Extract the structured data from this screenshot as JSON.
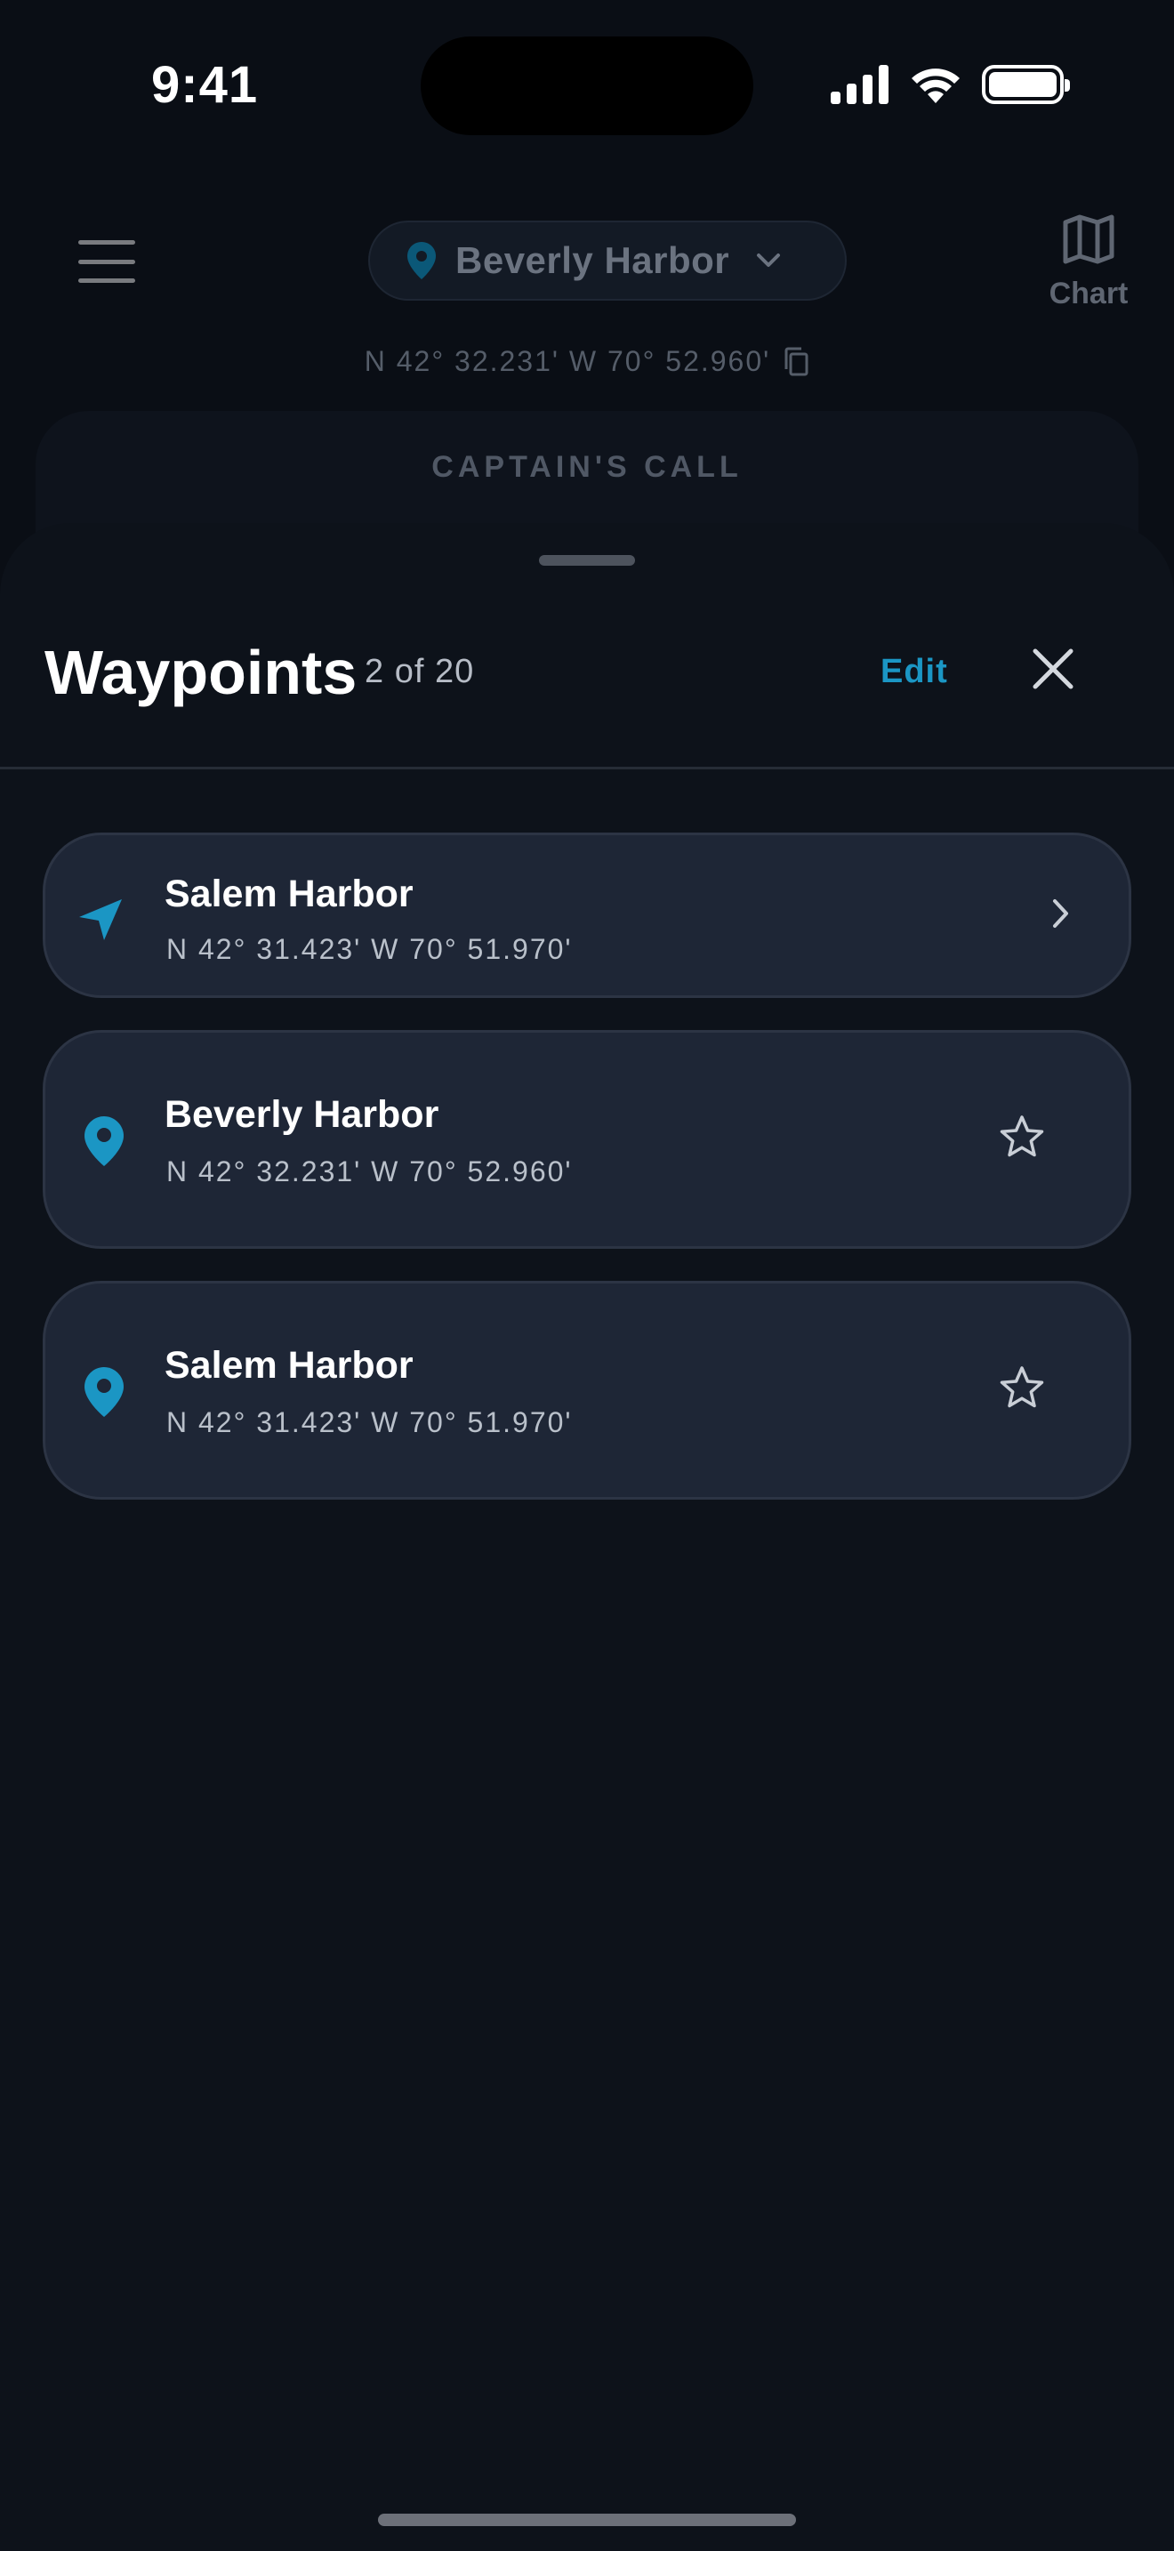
{
  "status_bar": {
    "time": "9:41"
  },
  "header": {
    "location_name": "Beverly Harbor",
    "chart_label": "Chart",
    "coordinates": "N 42° 32.231'  W 70° 52.960'"
  },
  "captain_call": {
    "label": "CAPTAIN'S CALL"
  },
  "sheet": {
    "title": "Waypoints",
    "count": "2 of 20",
    "edit_label": "Edit"
  },
  "waypoints": [
    {
      "name": "Salem Harbor",
      "coords": "N 42° 31.423'  W 70° 51.970'",
      "icon": "navigation-arrow-icon",
      "action": "chevron-right-icon"
    },
    {
      "name": "Beverly Harbor",
      "coords": "N 42° 32.231'  W 70° 52.960'",
      "icon": "map-pin-icon",
      "action": "star-outline-icon"
    },
    {
      "name": "Salem Harbor",
      "coords": "N 42° 31.423'  W 70° 51.970'",
      "icon": "map-pin-icon",
      "action": "star-outline-icon"
    }
  ],
  "colors": {
    "accent": "#1b96c4",
    "card": "#1e2636",
    "sheet": "#0d121a",
    "background": "#0a0e15"
  }
}
